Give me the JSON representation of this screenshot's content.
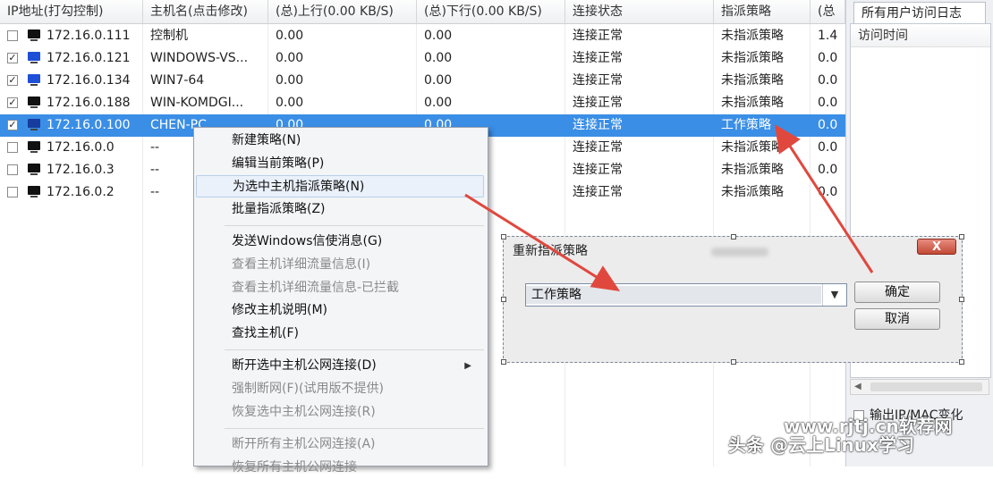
{
  "columns": [
    "IP地址(打勾控制)",
    "主机名(点击修改)",
    "(总)上行(0.00 KB/S)",
    "(总)下行(0.00 KB/S)",
    "连接状态",
    "指派策略",
    "(总"
  ],
  "rows": [
    {
      "checked": "",
      "icon": "black",
      "ip": "172.16.0.111",
      "host": "控制机",
      "up": "0.00",
      "down": "0.00",
      "status": "连接正常",
      "policy": "未指派策略",
      "extra": "1.4"
    },
    {
      "checked": "✓",
      "icon": "blue",
      "ip": "172.16.0.121",
      "host": "WINDOWS-VS...",
      "up": "0.00",
      "down": "0.00",
      "status": "连接正常",
      "policy": "未指派策略",
      "extra": "0.0"
    },
    {
      "checked": "✓",
      "icon": "blue",
      "ip": "172.16.0.134",
      "host": "WIN7-64",
      "up": "0.00",
      "down": "0.00",
      "status": "连接正常",
      "policy": "未指派策略",
      "extra": "0.0"
    },
    {
      "checked": "✓",
      "icon": "black",
      "ip": "172.16.0.188",
      "host": "WIN-KOMDGI...",
      "up": "0.00",
      "down": "0.00",
      "status": "连接正常",
      "policy": "未指派策略",
      "extra": "0.0"
    },
    {
      "checked": "✓",
      "icon": "blue",
      "ip": "172.16.0.100",
      "host": "CHEN-PC",
      "up": "0.00",
      "down": "0.00",
      "status": "连接正常",
      "policy": "工作策略",
      "extra": "0.0"
    },
    {
      "checked": "",
      "icon": "black",
      "ip": "172.16.0.0",
      "host": "--",
      "up": "",
      "down": "",
      "status": "连接正常",
      "policy": "未指派策略",
      "extra": "0.0"
    },
    {
      "checked": "",
      "icon": "black",
      "ip": "172.16.0.3",
      "host": "--",
      "up": "",
      "down": "",
      "status": "连接正常",
      "policy": "未指派策略",
      "extra": "0.0"
    },
    {
      "checked": "",
      "icon": "black",
      "ip": "172.16.0.2",
      "host": "--",
      "up": "",
      "down": "",
      "status": "连接正常",
      "policy": "未指派策略",
      "extra": "0.0"
    }
  ],
  "right_panel": {
    "tab_label": "所有用户访问日志",
    "column_header": "访问时间",
    "checkbox_label": "输出IP/MAC变化"
  },
  "context_menu": {
    "items": [
      {
        "label": "新建策略(N)",
        "disabled": false,
        "highlighted": false,
        "submenu": false
      },
      {
        "label": "编辑当前策略(P)",
        "disabled": false,
        "highlighted": false,
        "submenu": false
      },
      {
        "label": "为选中主机指派策略(N)",
        "disabled": false,
        "highlighted": true,
        "submenu": false
      },
      {
        "label": "批量指派策略(Z)",
        "disabled": false,
        "highlighted": false,
        "submenu": false
      },
      {
        "separator": true
      },
      {
        "label": "发送Windows信使消息(G)",
        "disabled": false,
        "highlighted": false,
        "submenu": false
      },
      {
        "label": "查看主机详细流量信息(I)",
        "disabled": true,
        "highlighted": false,
        "submenu": false
      },
      {
        "label": "查看主机详细流量信息-已拦截",
        "disabled": true,
        "highlighted": false,
        "submenu": false
      },
      {
        "label": "修改主机说明(M)",
        "disabled": false,
        "highlighted": false,
        "submenu": false
      },
      {
        "label": "查找主机(F)",
        "disabled": false,
        "highlighted": false,
        "submenu": false
      },
      {
        "separator": true
      },
      {
        "label": "断开选中主机公网连接(D)",
        "disabled": false,
        "highlighted": false,
        "submenu": true
      },
      {
        "label": "强制断网(F)(试用版不提供)",
        "disabled": true,
        "highlighted": false,
        "submenu": false
      },
      {
        "label": "恢复选中主机公网连接(R)",
        "disabled": true,
        "highlighted": false,
        "submenu": false
      },
      {
        "separator": true
      },
      {
        "label": "断开所有主机公网连接(A)",
        "disabled": true,
        "highlighted": false,
        "submenu": false
      },
      {
        "label": "恢复所有主机公网连接",
        "disabled": true,
        "highlighted": false,
        "submenu": false
      }
    ]
  },
  "dialog": {
    "title": "重新指派策略",
    "close_label": "X",
    "select_value": "工作策略",
    "ok_label": "确定",
    "cancel_label": "取消"
  },
  "watermark": {
    "line1": "www.rjtj.cn软荐网",
    "line2": "头条 @云上Linux学习"
  },
  "colors": {
    "selection": "#3a8ee6",
    "arrow": "#e0483e",
    "close_button": "#c24a36"
  }
}
